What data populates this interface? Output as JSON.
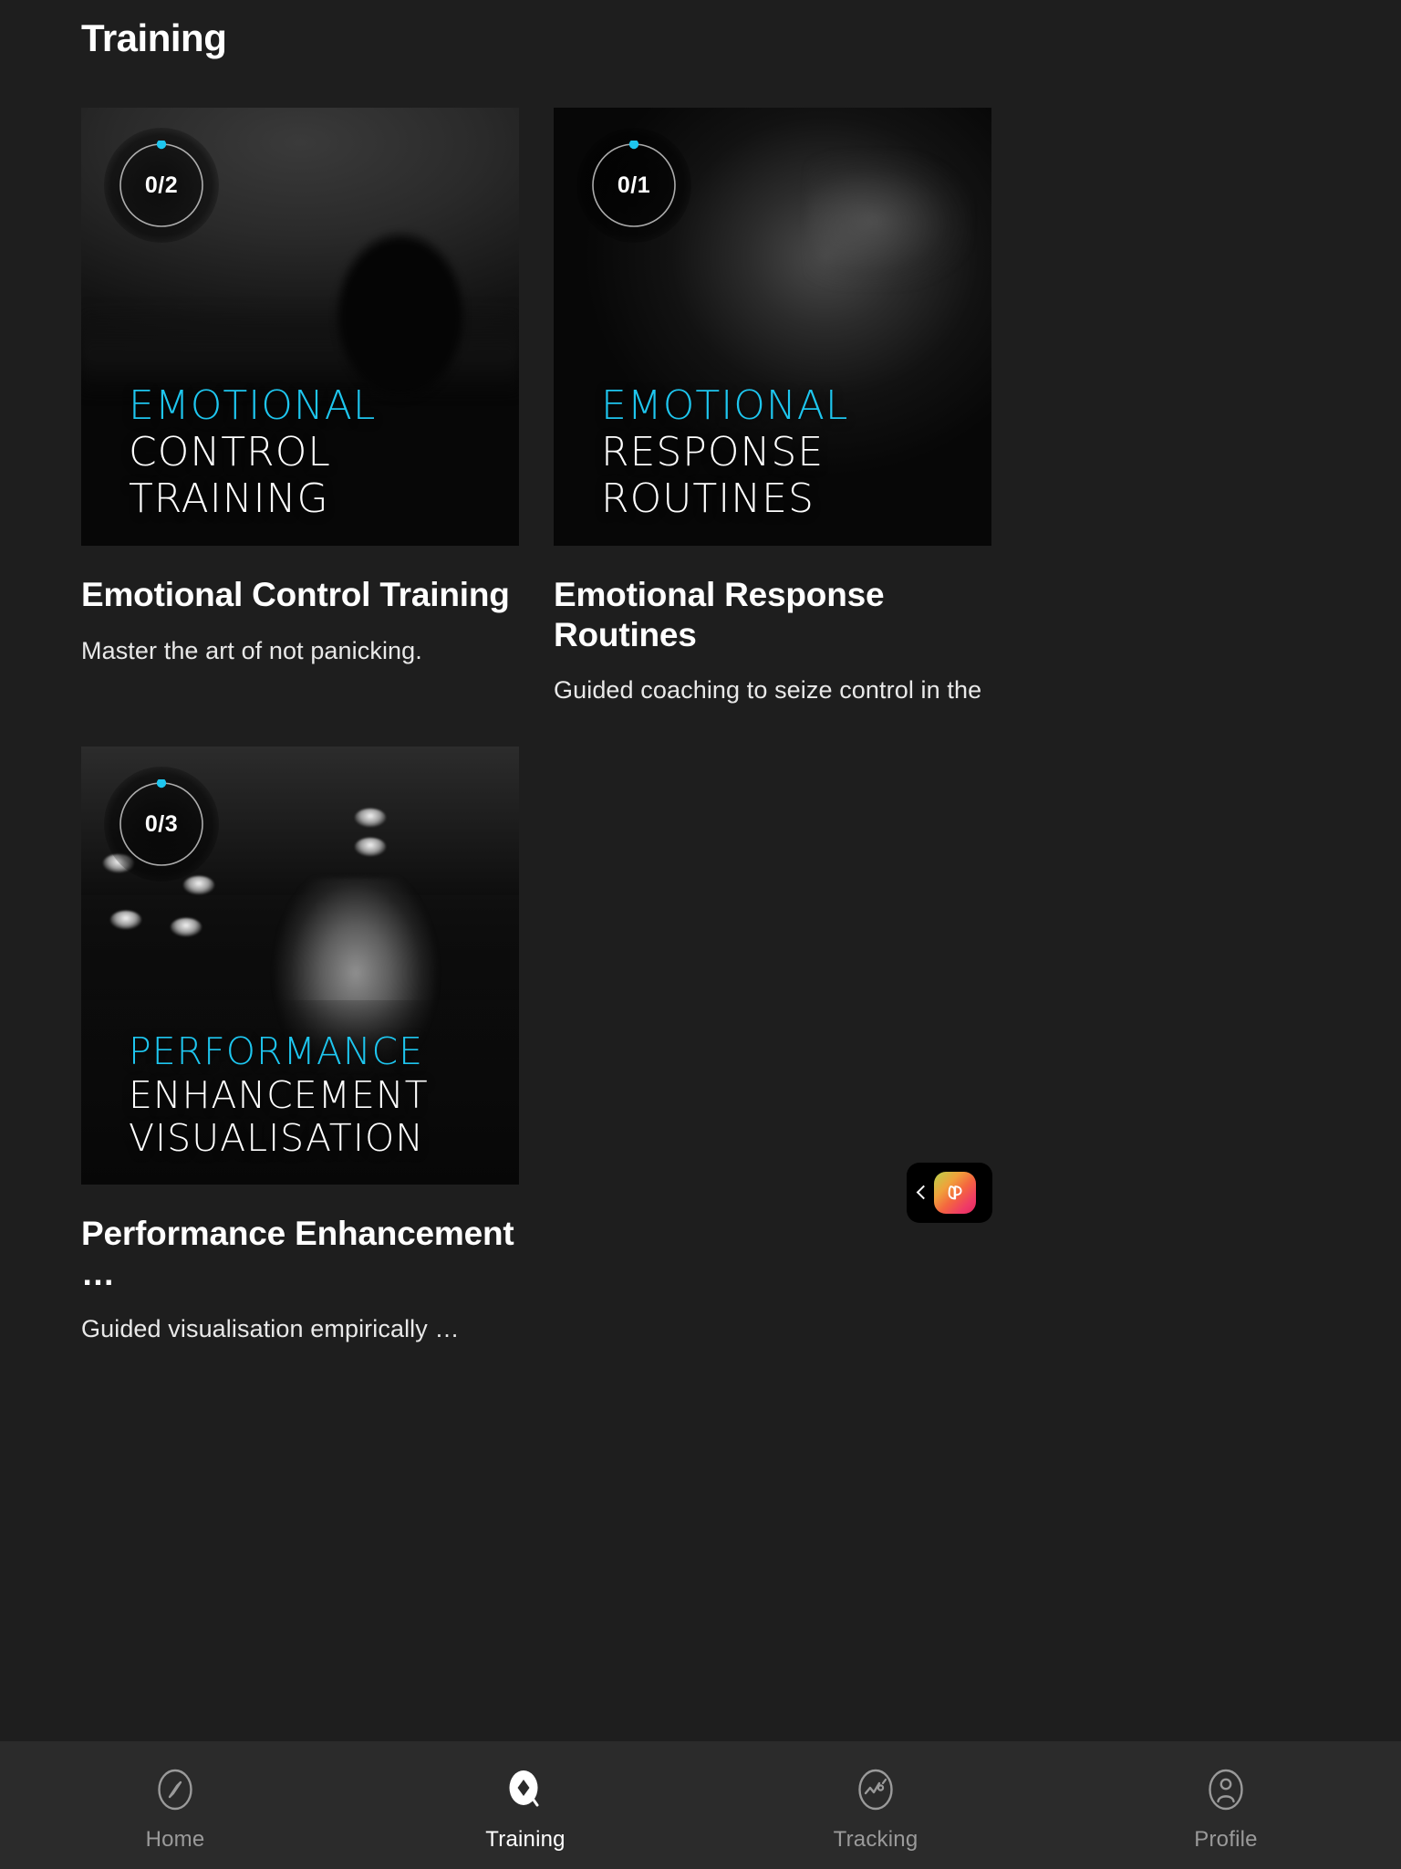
{
  "page": {
    "title": "Training",
    "background_color": "#1e1e1e",
    "accent_color": "#1ec6ef"
  },
  "cards": [
    {
      "progress_label": "0/2",
      "progress_current": 0,
      "progress_total": 2,
      "media_caption": {
        "line1": "EMOTIONAL",
        "line2": "CONTROL",
        "line3": "TRAINING"
      },
      "title": "Emotional Control Training",
      "description": "Master the art of not panicking."
    },
    {
      "progress_label": "0/1",
      "progress_current": 0,
      "progress_total": 1,
      "media_caption": {
        "line1": "EMOTIONAL",
        "line2": "RESPONSE",
        "line3": "ROUTINES"
      },
      "title": "Emotional Response Routines",
      "description": "Guided coaching to seize control in the …"
    },
    {
      "progress_label": "0/3",
      "progress_current": 0,
      "progress_total": 3,
      "media_caption": {
        "line1": "PERFORMANCE",
        "line2": "ENHANCEMENT",
        "line3": "VISUALISATION"
      },
      "title": "Performance Enhancement …",
      "description": "Guided visualisation empirically …"
    }
  ],
  "floating_widget": {
    "collapse_icon": "chevron-left-icon",
    "brand_icon": "brand-logo-icon"
  },
  "bottom_nav": {
    "items": [
      {
        "label": "Home",
        "icon": "compass-icon",
        "active": false
      },
      {
        "label": "Training",
        "icon": "diamond-icon",
        "active": true
      },
      {
        "label": "Tracking",
        "icon": "trendline-icon",
        "active": false
      },
      {
        "label": "Profile",
        "icon": "person-icon",
        "active": false
      }
    ]
  }
}
